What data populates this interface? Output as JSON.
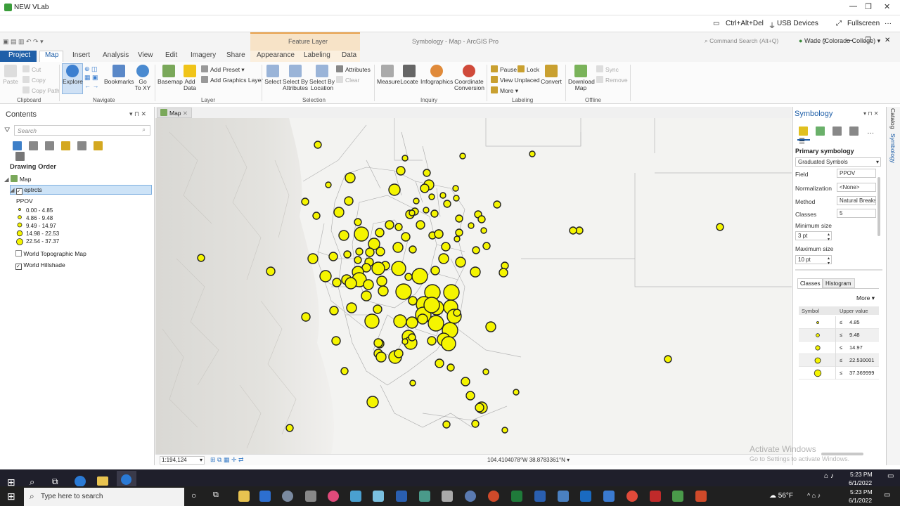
{
  "vlab": {
    "title": "NEW VLab",
    "min": "—",
    "max": "❐",
    "close": "✕"
  },
  "vlab_tools": {
    "ctrl_alt_del": "Ctrl+Alt+Del",
    "usb": "USB Devices",
    "fullscreen": "Fullscreen",
    "more": "···"
  },
  "app": {
    "title": "Symbology - Map - ArcGIS Pro",
    "context_tab_group": "Feature Layer",
    "command_search_placeholder": "Command Search (Alt+Q)",
    "user": "Wade (Colorado College)",
    "help": "?",
    "min": "—",
    "max": "❐",
    "close": "✕"
  },
  "tabs": [
    {
      "label": "Project"
    },
    {
      "label": "Map"
    },
    {
      "label": "Insert"
    },
    {
      "label": "Analysis"
    },
    {
      "label": "View"
    },
    {
      "label": "Edit"
    },
    {
      "label": "Imagery"
    },
    {
      "label": "Share"
    },
    {
      "label": "Appearance"
    },
    {
      "label": "Labeling"
    },
    {
      "label": "Data"
    }
  ],
  "ribbon": {
    "clipboard": {
      "group": "Clipboard",
      "paste": "Paste",
      "cut": "Cut",
      "copy": "Copy",
      "copy_path": "Copy Path"
    },
    "navigate": {
      "group": "Navigate",
      "explore": "Explore",
      "bookmarks": "Bookmarks",
      "goto": "Go\nTo XY"
    },
    "layer": {
      "group": "Layer",
      "basemap": "Basemap",
      "add_data": "Add\nData",
      "add_preset": "Add Preset",
      "add_graphics": "Add Graphics Layer"
    },
    "selection": {
      "group": "Selection",
      "select": "Select",
      "select_by_attr": "Select By\nAttributes",
      "select_by_loc": "Select By\nLocation",
      "attributes": "Attributes",
      "clear": "Clear"
    },
    "inquiry": {
      "group": "Inquiry",
      "measure": "Measure",
      "locate": "Locate",
      "infographics": "Infographics",
      "coord": "Coordinate\nConversion"
    },
    "labeling": {
      "group": "Labeling",
      "pause": "Pause",
      "lock": "Lock",
      "view_unplaced": "View Unplaced",
      "more": "More",
      "convert": "Convert"
    },
    "offline": {
      "group": "Offline",
      "download": "Download\nMap",
      "sync": "Sync",
      "remove": "Remove"
    }
  },
  "contents": {
    "title": "Contents",
    "search_placeholder": "Search",
    "drawing_order": "Drawing Order",
    "map": "Map",
    "layer": "eptrcts",
    "field": "PPOV",
    "classes": [
      "0.00 - 4.85",
      "4.86 - 9.48",
      "9.49 - 14.97",
      "14.98 - 22.53",
      "22.54 - 37.37"
    ],
    "topo": "World Topographic Map",
    "hillshade": "World Hillshade"
  },
  "map_tab": "Map",
  "status": {
    "scale": "1:194,124",
    "coords": "104.4104078°W 38.8783361°N"
  },
  "symbology": {
    "title": "Symbology",
    "primary": "Primary symbology",
    "type": "Graduated Symbols",
    "field_label": "Field",
    "field_value": "PPOV",
    "norm_label": "Normalization",
    "norm_value": "<None>",
    "method_label": "Method",
    "method_value": "Natural Breaks",
    "classes_label": "Classes",
    "classes_value": "5",
    "min_label": "Minimum size",
    "min_value": "3 pt",
    "max_label": "Maximum size",
    "max_value": "10 pt",
    "tab_classes": "Classes",
    "tab_histogram": "Histogram",
    "more": "More",
    "col_symbol": "Symbol",
    "col_upper": "Upper value",
    "rows": [
      {
        "op": "≤",
        "value": "4.85"
      },
      {
        "op": "≤",
        "value": "9.48"
      },
      {
        "op": "≤",
        "value": "14.97"
      },
      {
        "op": "≤",
        "value": "22.530001"
      },
      {
        "op": "≤",
        "value": "37.369999"
      }
    ]
  },
  "side_tabs": {
    "catalog": "Catalog",
    "symbology": "Symbology"
  },
  "watermark": {
    "line1": "Activate Windows",
    "line2": "Go to Settings to activate Windows."
  },
  "taskbar": {
    "search_placeholder": "Type here to search",
    "weather": "56°F",
    "time": "5:23 PM",
    "date": "6/1/2022"
  },
  "colors": {
    "accent": "#1f5fa8",
    "point_fill": "#f5f500",
    "point_stroke": "#222222"
  }
}
